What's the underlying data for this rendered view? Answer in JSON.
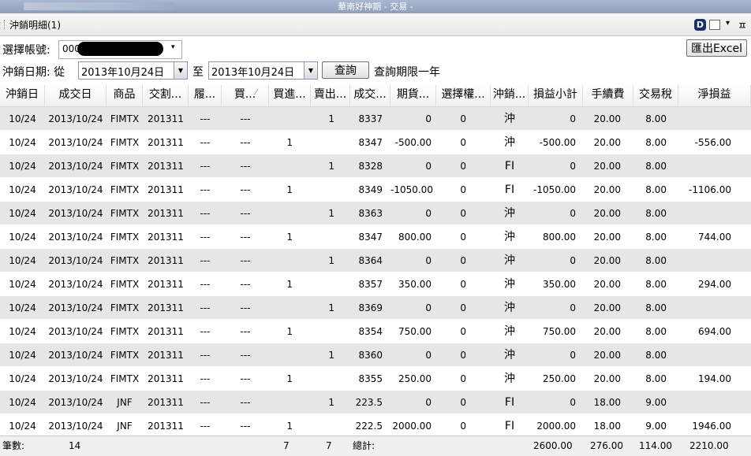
{
  "window": {
    "title": "華南好神期 - 交易 -"
  },
  "tab": {
    "title": "沖銷明細(1)",
    "d_icon_letter": "D",
    "dropdown_glyph": "▾",
    "pin_glyph": "ㅍ"
  },
  "controls": {
    "account_label": "選擇帳號:",
    "account_prefix": "000",
    "account_dropdown_glyph": "▾",
    "date_label": "沖銷日期: 從",
    "date_from": "2013年10月24日",
    "to_label": "至",
    "date_to": "2013年10月24日",
    "date_drop_glyph": "▼",
    "query_button": "查詢",
    "query_note": "查詢期限一年",
    "export_button": "匯出Excel"
  },
  "table": {
    "headers": [
      "沖銷日",
      "成交日",
      "商品",
      "交割...",
      "履...",
      "買...",
      "買進...",
      "賣出...",
      "成交...",
      "期貨...",
      "選擇權...",
      "沖銷...",
      "損益小計",
      "手續費",
      "交易稅",
      "淨損益"
    ],
    "sort_glyph": "⁄",
    "rows": [
      [
        "10/24",
        "2013/10/24",
        "FIMTX",
        "201311",
        "---",
        "---",
        "",
        "1",
        "8337",
        "0",
        "0",
        "沖",
        "0",
        "20.00",
        "8.00",
        ""
      ],
      [
        "10/24",
        "2013/10/24",
        "FIMTX",
        "201311",
        "---",
        "---",
        "1",
        "",
        "8347",
        "-500.00",
        "0",
        "沖",
        "-500.00",
        "20.00",
        "8.00",
        "-556.00"
      ],
      [
        "10/24",
        "2013/10/24",
        "FIMTX",
        "201311",
        "---",
        "---",
        "",
        "1",
        "8328",
        "0",
        "0",
        "FI",
        "0",
        "20.00",
        "8.00",
        ""
      ],
      [
        "10/24",
        "2013/10/24",
        "FIMTX",
        "201311",
        "---",
        "---",
        "1",
        "",
        "8349",
        "-1050.00",
        "0",
        "FI",
        "-1050.00",
        "20.00",
        "8.00",
        "-1106.00"
      ],
      [
        "10/24",
        "2013/10/24",
        "FIMTX",
        "201311",
        "---",
        "---",
        "",
        "1",
        "8363",
        "0",
        "0",
        "沖",
        "0",
        "20.00",
        "8.00",
        ""
      ],
      [
        "10/24",
        "2013/10/24",
        "FIMTX",
        "201311",
        "---",
        "---",
        "1",
        "",
        "8347",
        "800.00",
        "0",
        "沖",
        "800.00",
        "20.00",
        "8.00",
        "744.00"
      ],
      [
        "10/24",
        "2013/10/24",
        "FIMTX",
        "201311",
        "---",
        "---",
        "",
        "1",
        "8364",
        "0",
        "0",
        "沖",
        "0",
        "20.00",
        "8.00",
        ""
      ],
      [
        "10/24",
        "2013/10/24",
        "FIMTX",
        "201311",
        "---",
        "---",
        "1",
        "",
        "8357",
        "350.00",
        "0",
        "沖",
        "350.00",
        "20.00",
        "8.00",
        "294.00"
      ],
      [
        "10/24",
        "2013/10/24",
        "FIMTX",
        "201311",
        "---",
        "---",
        "",
        "1",
        "8369",
        "0",
        "0",
        "沖",
        "0",
        "20.00",
        "8.00",
        ""
      ],
      [
        "10/24",
        "2013/10/24",
        "FIMTX",
        "201311",
        "---",
        "---",
        "1",
        "",
        "8354",
        "750.00",
        "0",
        "沖",
        "750.00",
        "20.00",
        "8.00",
        "694.00"
      ],
      [
        "10/24",
        "2013/10/24",
        "FIMTX",
        "201311",
        "---",
        "---",
        "",
        "1",
        "8360",
        "0",
        "0",
        "沖",
        "0",
        "20.00",
        "8.00",
        ""
      ],
      [
        "10/24",
        "2013/10/24",
        "FIMTX",
        "201311",
        "---",
        "---",
        "1",
        "",
        "8355",
        "250.00",
        "0",
        "沖",
        "250.00",
        "20.00",
        "8.00",
        "194.00"
      ],
      [
        "10/24",
        "2013/10/24",
        "JNF",
        "201311",
        "---",
        "---",
        "",
        "1",
        "223.5",
        "0",
        "0",
        "FI",
        "0",
        "18.00",
        "9.00",
        ""
      ],
      [
        "10/24",
        "2013/10/24",
        "JNF",
        "201311",
        "---",
        "---",
        "1",
        "",
        "222.5",
        "2000.00",
        "0",
        "FI",
        "2000.00",
        "18.00",
        "9.00",
        "1946.00"
      ]
    ]
  },
  "footer": {
    "count_label": "筆數:",
    "count": "14",
    "buy_total": "7",
    "sell_total": "7",
    "total_label": "總計:",
    "pnl_total": "2600.00",
    "fee_total": "276.00",
    "tax_total": "114.00",
    "net_total": "2210.00"
  }
}
